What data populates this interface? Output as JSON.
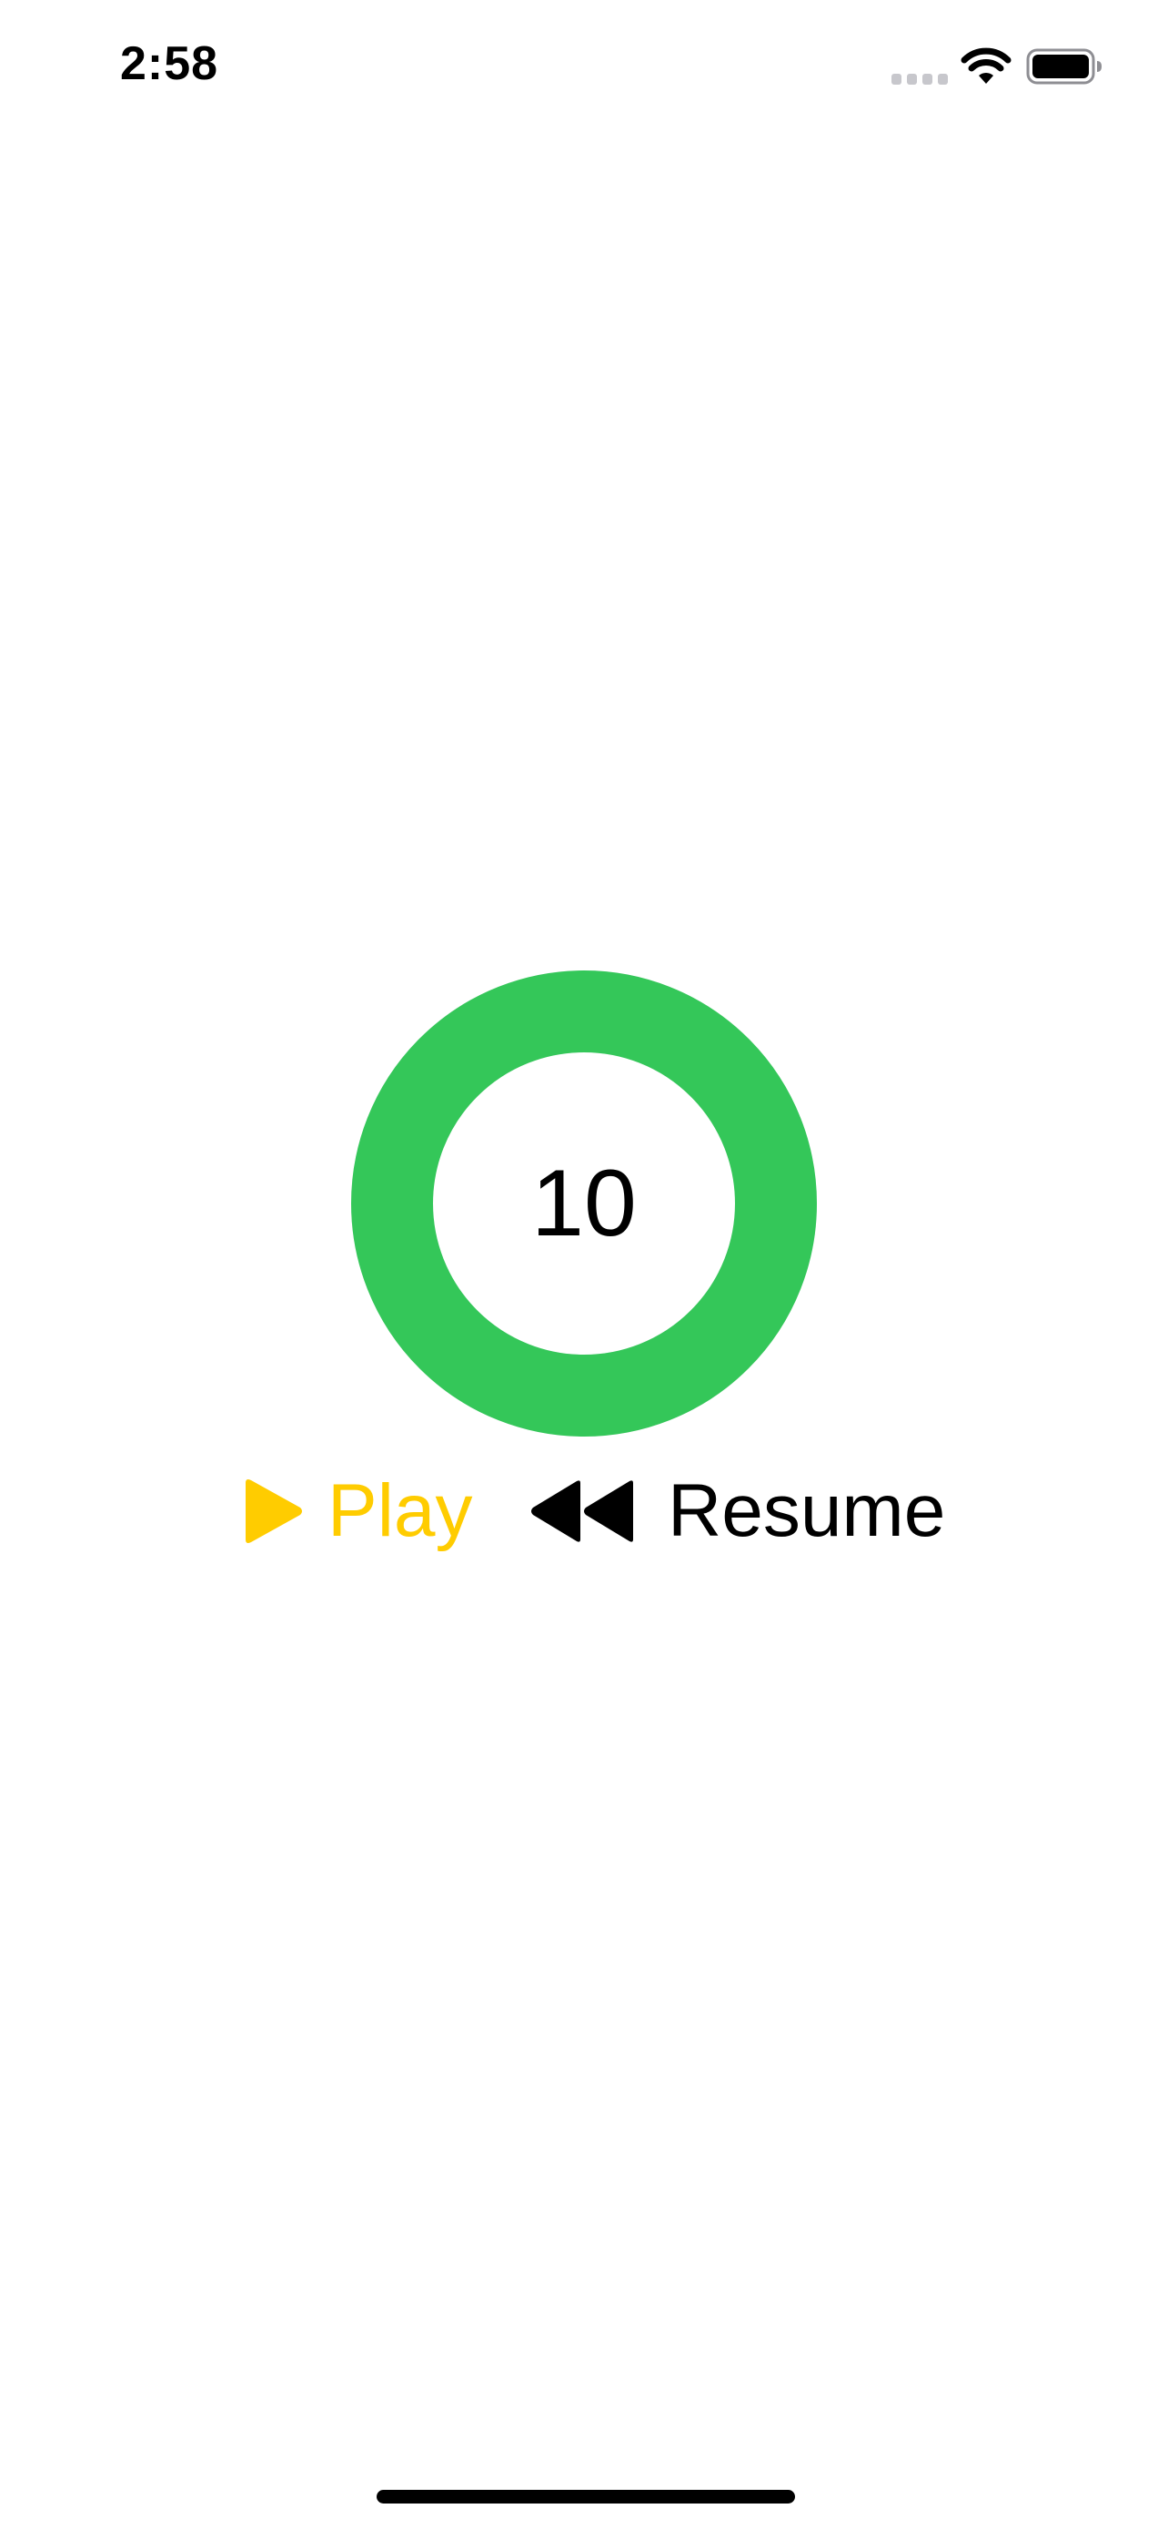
{
  "status_bar": {
    "time": "2:58",
    "icons": [
      "cellular-signal-icon",
      "wifi-icon",
      "battery-icon"
    ]
  },
  "timer": {
    "value": "10",
    "ring_color": "#34C759",
    "progress": 1.0
  },
  "controls": {
    "play": {
      "label": "Play",
      "icon": "play-icon",
      "color": "#FFCC00"
    },
    "resume": {
      "label": "Resume",
      "icon": "rewind-icon",
      "color": "#000000"
    }
  }
}
